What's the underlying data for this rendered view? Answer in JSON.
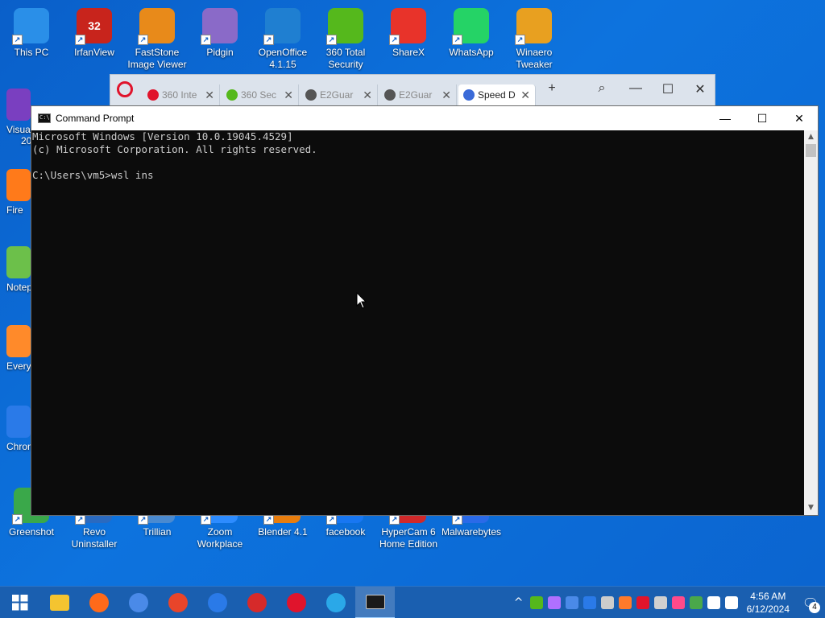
{
  "desktop": {
    "icons_top": [
      {
        "label": "This PC",
        "color": "#2a8fe8"
      },
      {
        "label": "IrfanView",
        "color": "#c8241c",
        "badge": "32"
      },
      {
        "label": "FastStone Image Viewer",
        "color": "#e88a1a"
      },
      {
        "label": "Pidgin",
        "color": "#8a6ac8"
      },
      {
        "label": "OpenOffice 4.1.15",
        "color": "#1f7fd1"
      },
      {
        "label": "360 Total Security",
        "color": "#55b81c"
      },
      {
        "label": "ShareX",
        "color": "#e8332a"
      },
      {
        "label": "WhatsApp",
        "color": "#25d366"
      },
      {
        "label": "Winaero Tweaker",
        "color": "#e8a020"
      }
    ],
    "icons_left_partial": [
      {
        "label": "Visual",
        "label2": "20",
        "color": "#7a3fc0"
      },
      {
        "label": "Fire",
        "color": "#ff7a1a"
      },
      {
        "label": "Notep",
        "color": "#6cc04a"
      },
      {
        "label": "Every",
        "color": "#ff8a2a"
      },
      {
        "label": "Chron",
        "color": "#2a7ae8"
      }
    ],
    "icons_bottom": [
      {
        "label": "Greenshot",
        "color": "#3aa84a"
      },
      {
        "label": "Revo Uninstaller",
        "color": "#2a6ac0"
      },
      {
        "label": "Trillian",
        "color": "#4a8ad0"
      },
      {
        "label": "Zoom Workplace",
        "color": "#2d8cff"
      },
      {
        "label": "Blender 4.1",
        "color": "#e87d0d"
      },
      {
        "label": "facebook",
        "color": "#1877f2"
      },
      {
        "label": "HyperCam 6 Home Edition",
        "color": "#d0282a"
      },
      {
        "label": "Malwarebytes",
        "color": "#2a6ae8"
      }
    ]
  },
  "browser": {
    "tabs": [
      {
        "label": "360 Inte",
        "icon_color": "#e0142c"
      },
      {
        "label": "360 Sec",
        "icon_color": "#55b81c"
      },
      {
        "label": "E2Guar",
        "icon_color": "#555555"
      },
      {
        "label": "E2Guar",
        "icon_color": "#555555"
      },
      {
        "label": "Speed D",
        "icon_color": "#3a6ad8",
        "active": true
      }
    ],
    "new_tab": "+",
    "search": "⌕",
    "minimize": "—",
    "maximize": "☐",
    "close": "✕"
  },
  "cmd": {
    "title": "Command Prompt",
    "icon_text": "C:\\",
    "minimize": "—",
    "maximize": "☐",
    "close": "✕",
    "lines": [
      "Microsoft Windows [Version 10.0.19045.4529]",
      "(c) Microsoft Corporation. All rights reserved.",
      "",
      "C:\\Users\\vm5>wsl ins"
    ]
  },
  "taskbar": {
    "apps": [
      {
        "name": "start-button",
        "color": "#ffffff"
      },
      {
        "name": "file-explorer",
        "color": "#f4c430"
      },
      {
        "name": "firefox",
        "color": "#ff6a1a"
      },
      {
        "name": "chrome",
        "color": "#4a8ae8"
      },
      {
        "name": "brave",
        "color": "#e8452a"
      },
      {
        "name": "thunderbird",
        "color": "#2a7ae8"
      },
      {
        "name": "wps-office",
        "color": "#d62a2a"
      },
      {
        "name": "opera",
        "color": "#e0142c"
      },
      {
        "name": "app-blue",
        "color": "#2aa8e8"
      },
      {
        "name": "command-prompt",
        "color": "#1a1a1a",
        "active": true
      }
    ],
    "tray_icons": [
      "#ffffff",
      "#55b81c",
      "#b070ff",
      "#4a8ae8",
      "#2a7ae8",
      "#cccccc",
      "#ff7a2a",
      "#e0142c",
      "#d0d0d0",
      "#ff4a8a",
      "#4aa84a",
      "#ffffff",
      "#ffffff"
    ],
    "time": "4:56 AM",
    "date": "6/12/2024",
    "notification_count": "4"
  }
}
